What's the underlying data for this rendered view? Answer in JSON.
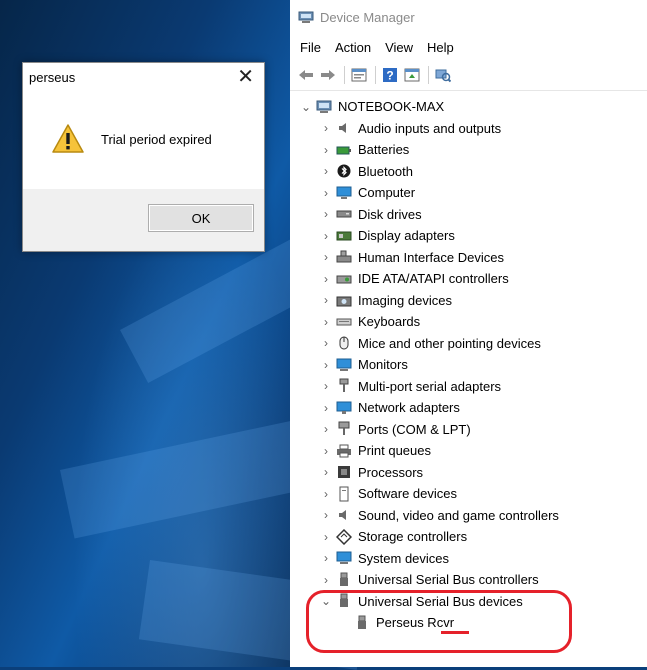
{
  "colors": {
    "desktop": "#0b3f7a",
    "highlight": "#e5212a"
  },
  "dialog": {
    "title": "perseus",
    "close_glyph": "✕",
    "message": "Trial period expired",
    "ok_label": "OK",
    "icon": "warning-icon"
  },
  "device_manager": {
    "title": "Device Manager",
    "menu": [
      "File",
      "Action",
      "View",
      "Help"
    ],
    "root": "NOTEBOOK-MAX",
    "categories": [
      {
        "label": "Audio inputs and outputs",
        "icon": "speaker-icon",
        "chev": "›"
      },
      {
        "label": "Batteries",
        "icon": "battery-icon",
        "chev": "›"
      },
      {
        "label": "Bluetooth",
        "icon": "bluetooth-icon",
        "chev": "›"
      },
      {
        "label": "Computer",
        "icon": "computer-icon",
        "chev": "›"
      },
      {
        "label": "Disk drives",
        "icon": "disk-drive-icon",
        "chev": "›"
      },
      {
        "label": "Display adapters",
        "icon": "display-adapter-icon",
        "chev": "›"
      },
      {
        "label": "Human Interface Devices",
        "icon": "hid-icon",
        "chev": "›"
      },
      {
        "label": "IDE ATA/ATAPI controllers",
        "icon": "ide-controller-icon",
        "chev": "›"
      },
      {
        "label": "Imaging devices",
        "icon": "camera-icon",
        "chev": "›"
      },
      {
        "label": "Keyboards",
        "icon": "keyboard-icon",
        "chev": "›"
      },
      {
        "label": "Mice and other pointing devices",
        "icon": "mouse-icon",
        "chev": "›"
      },
      {
        "label": "Monitors",
        "icon": "monitor-icon",
        "chev": "›"
      },
      {
        "label": "Multi-port serial adapters",
        "icon": "serial-adapter-icon",
        "chev": "›"
      },
      {
        "label": "Network adapters",
        "icon": "network-adapter-icon",
        "chev": "›"
      },
      {
        "label": "Ports (COM & LPT)",
        "icon": "port-icon",
        "chev": "›"
      },
      {
        "label": "Print queues",
        "icon": "printer-icon",
        "chev": "›"
      },
      {
        "label": "Processors",
        "icon": "processor-icon",
        "chev": "›"
      },
      {
        "label": "Software devices",
        "icon": "software-device-icon",
        "chev": "›"
      },
      {
        "label": "Sound, video and game controllers",
        "icon": "sound-icon",
        "chev": "›"
      },
      {
        "label": "Storage controllers",
        "icon": "storage-icon",
        "chev": "›"
      },
      {
        "label": "System devices",
        "icon": "system-icon",
        "chev": "›"
      },
      {
        "label": "Universal Serial Bus controllers",
        "icon": "usb-icon",
        "chev": "›"
      },
      {
        "label": "Universal Serial Bus devices",
        "icon": "usb-icon",
        "chev": "⌄"
      }
    ],
    "usb_child": "Perseus Rcvr"
  }
}
